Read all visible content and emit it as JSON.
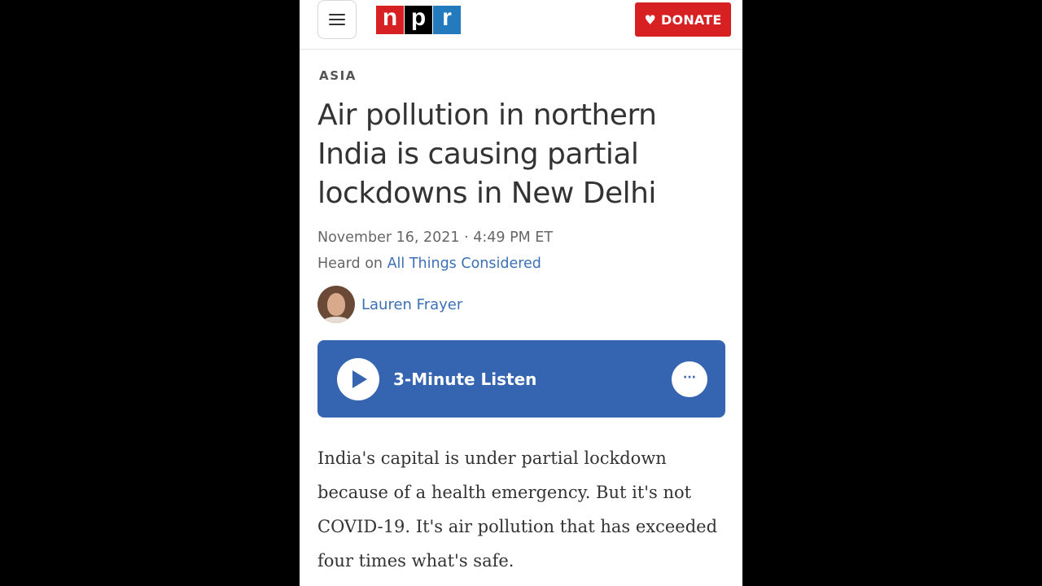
{
  "header": {
    "menu_icon": "hamburger-icon",
    "logo": [
      "n",
      "p",
      "r"
    ],
    "donate_label": "DONATE",
    "donate_icon": "heart-icon"
  },
  "article": {
    "section": "ASIA",
    "headline": "Air pollution in northern India is causing partial lockdowns in New Delhi",
    "dateline": "November 16, 2021 · 4:49 PM ET",
    "heard_on_prefix": "Heard on ",
    "program": "All Things Considered",
    "author": "Lauren Frayer",
    "listen_label": "3-Minute Listen",
    "more_label": "···",
    "body": "India's capital is under partial lockdown because of a health emergency. But it's not COVID-19. It's air pollution that has exceeded four times what's safe."
  },
  "colors": {
    "npr_red": "#d62021",
    "npr_blue": "#237bbd",
    "listen_blue": "#3565b0",
    "link_blue": "#3b6fb6"
  }
}
